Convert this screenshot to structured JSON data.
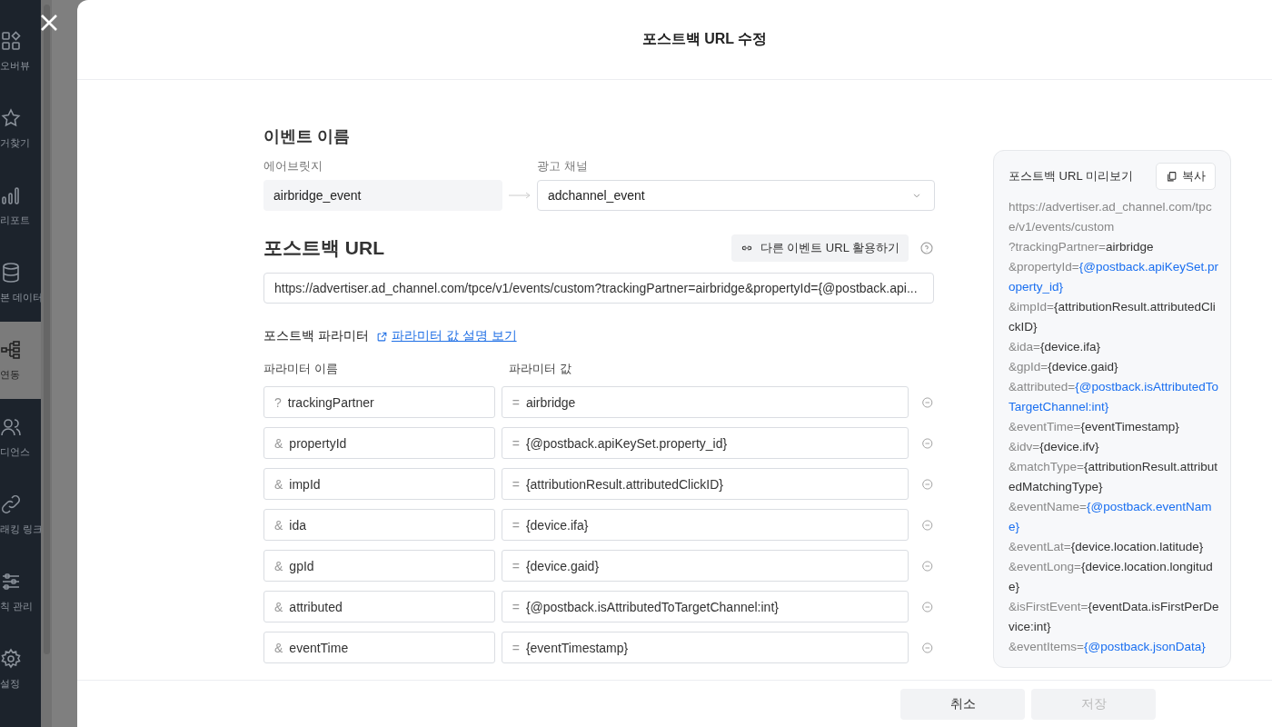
{
  "sidebar": {
    "items": [
      {
        "label": "오버뷰",
        "selected": false
      },
      {
        "label": "거찾기",
        "selected": false
      },
      {
        "label": "리포트",
        "selected": false
      },
      {
        "label": "본 데이터",
        "selected": false
      },
      {
        "label": "연동",
        "selected": true
      },
      {
        "label": "디언스",
        "selected": false
      },
      {
        "label": "래킹 링크",
        "selected": false
      },
      {
        "label": "칙 관리",
        "selected": false
      },
      {
        "label": "설정",
        "selected": false
      }
    ]
  },
  "modal": {
    "title": "포스트백 URL 수정",
    "event_name": {
      "heading": "이벤트 이름",
      "airbridge_label": "에어브릿지",
      "airbridge_value": "airbridge_event",
      "channel_label": "광고 채널",
      "channel_value": "adchannel_event"
    },
    "postback_url": {
      "heading": "포스트백 URL",
      "reuse_button": "다른 이벤트 URL 활용하기",
      "value": "https://advertiser.ad_channel.com/tpce/v1/events/custom?trackingPartner=airbridge&propertyId={@postback.api..."
    },
    "parameters": {
      "heading": "포스트백 파라미터",
      "help_link": "파라미터 값 설명 보기",
      "name_column": "파라미터 이름",
      "value_column": "파라미터 값",
      "rows": [
        {
          "prefix": "?",
          "name": "trackingPartner",
          "operator": "=",
          "value": "airbridge"
        },
        {
          "prefix": "&",
          "name": "propertyId",
          "operator": "=",
          "value": "{@postback.apiKeySet.property_id}"
        },
        {
          "prefix": "&",
          "name": "impId",
          "operator": "=",
          "value": "{attributionResult.attributedClickID}"
        },
        {
          "prefix": "&",
          "name": "ida",
          "operator": "=",
          "value": "{device.ifa}"
        },
        {
          "prefix": "&",
          "name": "gpId",
          "operator": "=",
          "value": "{device.gaid}"
        },
        {
          "prefix": "&",
          "name": "attributed",
          "operator": "=",
          "value": "{@postback.isAttributedToTargetChannel:int}"
        },
        {
          "prefix": "&",
          "name": "eventTime",
          "operator": "=",
          "value": "{eventTimestamp}"
        }
      ]
    },
    "preview": {
      "title": "포스트백 URL 미리보기",
      "copy_button": "복사",
      "lines": [
        {
          "key": "https://advertiser.ad_channel.com/tpce/v1/events/custom"
        },
        {
          "key": "?trackingPartner=",
          "value": "airbridge",
          "kind": "plain"
        },
        {
          "key": "&propertyId=",
          "value": "{@postback.apiKeySet.property_id}",
          "kind": "macro"
        },
        {
          "key": "&impId=",
          "value": "{attributionResult.attributedClickID}",
          "kind": "plain"
        },
        {
          "key": "&ida=",
          "value": "{device.ifa}",
          "kind": "plain"
        },
        {
          "key": "&gpId=",
          "value": "{device.gaid}",
          "kind": "plain"
        },
        {
          "key": "&attributed=",
          "value": "{@postback.isAttributedToTargetChannel:int}",
          "kind": "macro"
        },
        {
          "key": "&eventTime=",
          "value": "{eventTimestamp}",
          "kind": "plain"
        },
        {
          "key": "&idv=",
          "value": "{device.ifv}",
          "kind": "plain"
        },
        {
          "key": "&matchType=",
          "value": "{attributionResult.attributedMatchingType}",
          "kind": "plain"
        },
        {
          "key": "&eventName=",
          "value": "{@postback.eventName}",
          "kind": "macro"
        },
        {
          "key": "&eventLat=",
          "value": "{device.location.latitude}",
          "kind": "plain"
        },
        {
          "key": "&eventLong=",
          "value": "{device.location.longitude}",
          "kind": "plain"
        },
        {
          "key": "&isFirstEvent=",
          "value": "{eventData.isFirstPerDevice:int}",
          "kind": "plain"
        },
        {
          "key": "&eventItems=",
          "value": "{@postback.jsonData}",
          "kind": "macro"
        }
      ]
    },
    "footer": {
      "cancel_button": "취소",
      "save_button": {
        "label": "저장",
        "disabled": true
      }
    }
  }
}
